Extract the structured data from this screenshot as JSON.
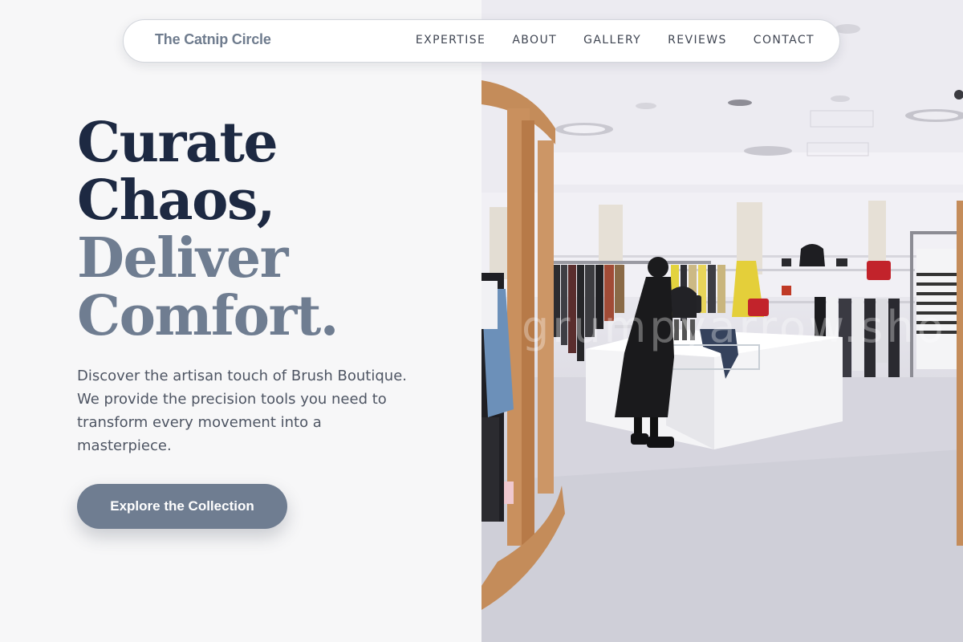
{
  "brand": {
    "name": "The Catnip Circle"
  },
  "nav": {
    "links": [
      "EXPERTISE",
      "ABOUT",
      "GALLERY",
      "REVIEWS",
      "CONTACT"
    ]
  },
  "hero": {
    "title_lines": [
      "Curate",
      "Chaos,",
      "Deliver",
      "Comfort."
    ],
    "description": "Discover the artisan touch of Brush Boutique. We provide the precision tools you need to transform every movement into a masterpiece.",
    "cta_label": "Explore the Collection"
  },
  "photo": {
    "watermark": "grumpyarrow.sho"
  },
  "colors": {
    "navy": "#1d2942",
    "slate": "#6f7d91",
    "text": "#4e5563",
    "background": "#f7f7f8"
  }
}
